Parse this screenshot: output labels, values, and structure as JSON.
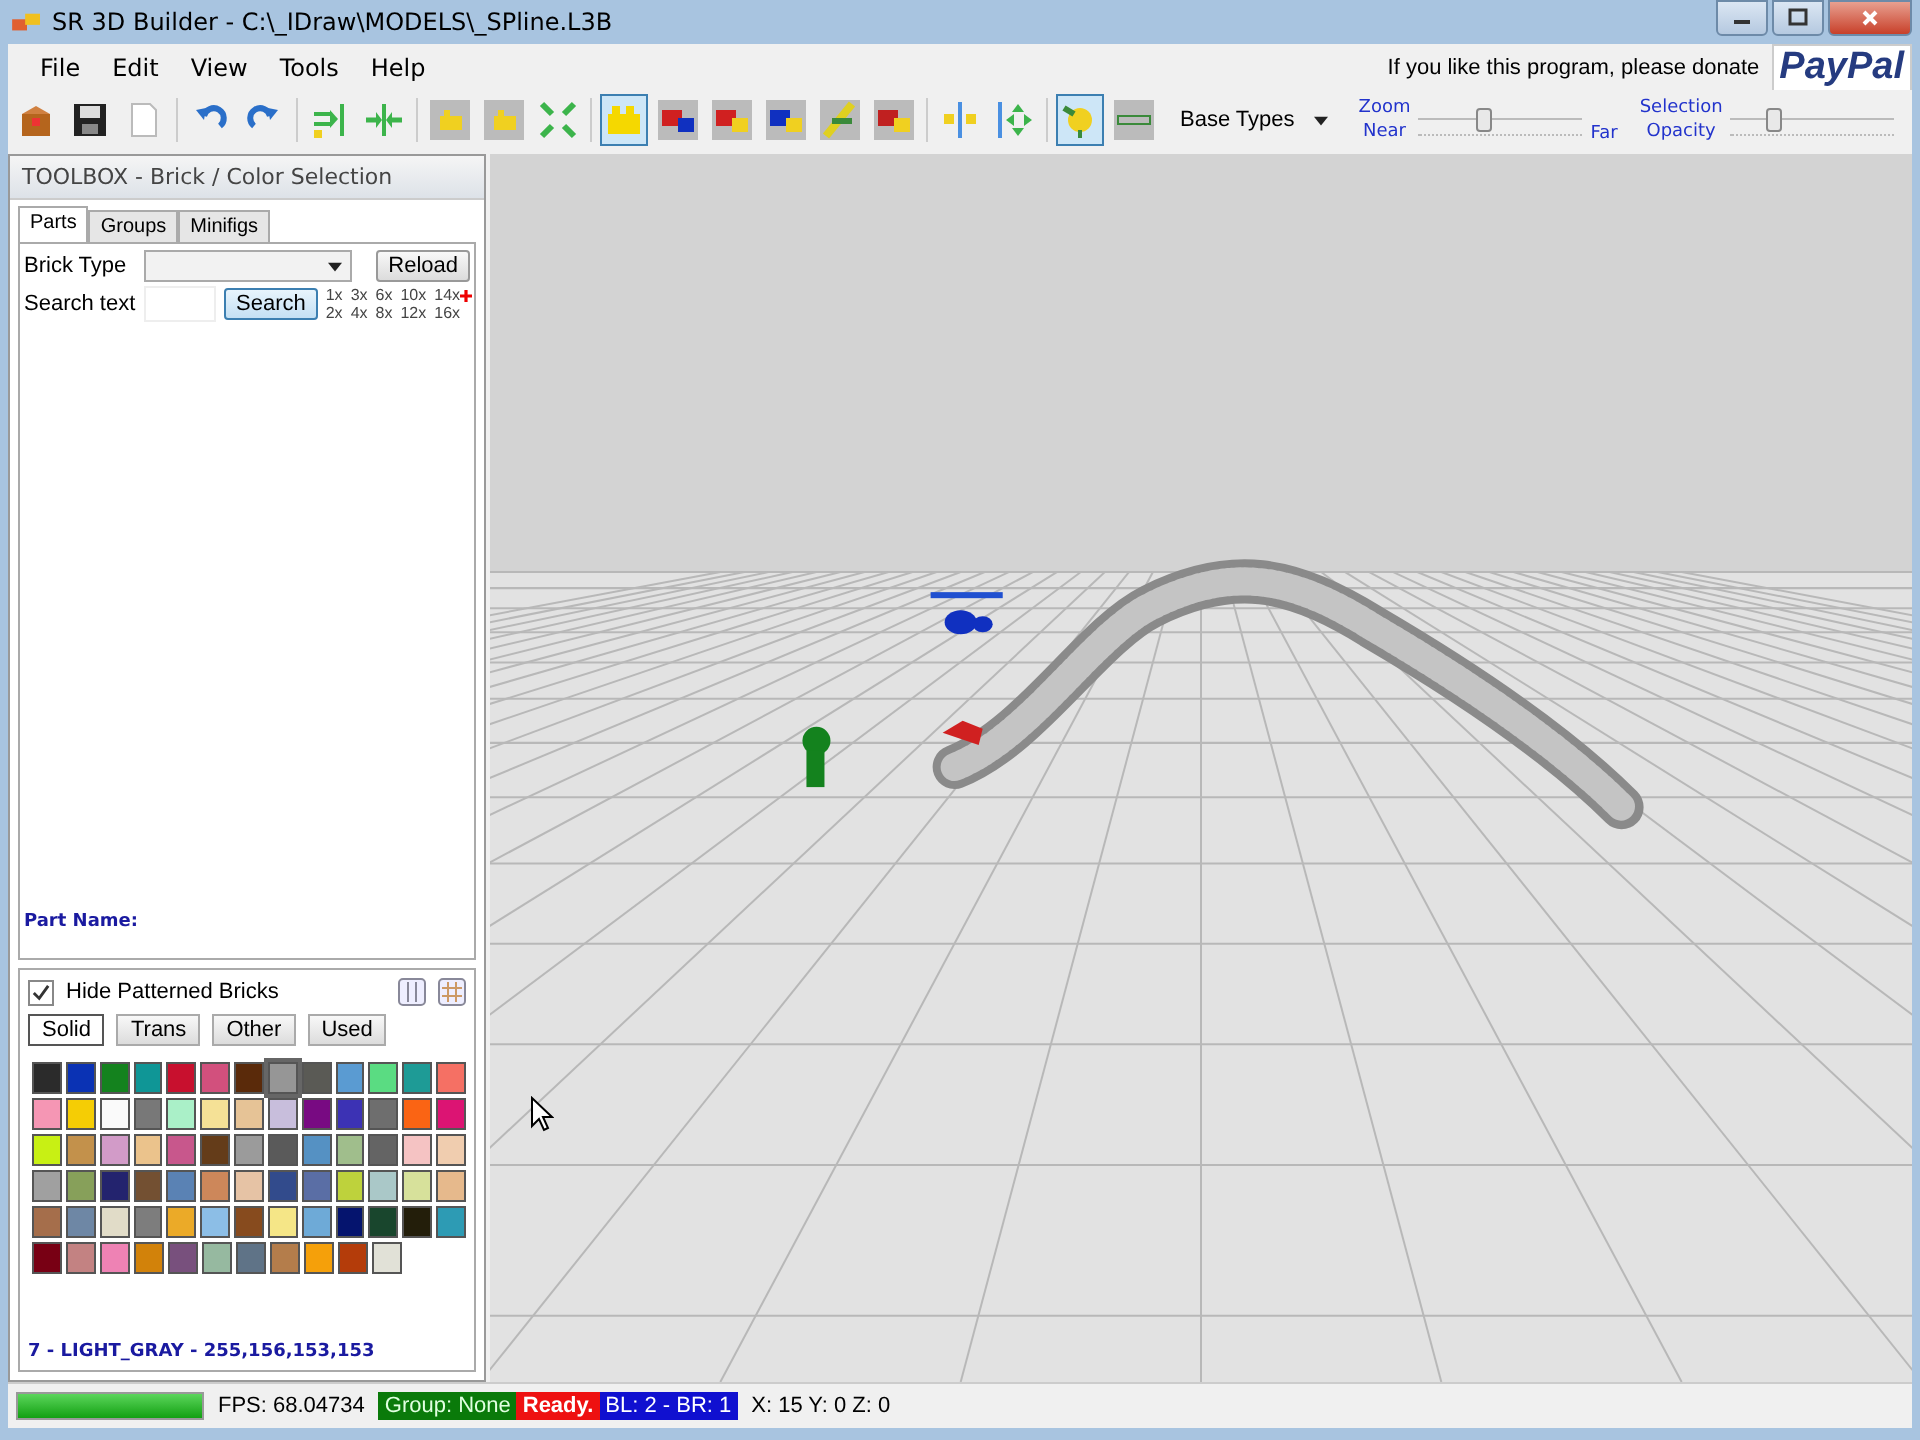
{
  "window": {
    "title": "SR 3D Builder - C:\\_IDraw\\MODELS\\_SPline.L3B"
  },
  "menu": [
    "File",
    "Edit",
    "View",
    "Tools",
    "Help"
  ],
  "donate": {
    "text": "If you like this program, please donate",
    "logo": "PayPal"
  },
  "toolbar": {
    "buttons": [
      {
        "selected": false
      },
      {
        "selected": false
      },
      {
        "selected": false
      },
      {
        "selected": false
      },
      {
        "selected": false
      },
      {
        "selected": false
      },
      {
        "selected": false
      },
      {
        "selected": false
      },
      {
        "selected": false
      },
      {
        "selected": false
      },
      {
        "selected": true
      },
      {
        "selected": false
      },
      {
        "selected": false
      },
      {
        "selected": false
      },
      {
        "selected": false
      },
      {
        "selected": false
      },
      {
        "selected": false
      },
      {
        "selected": false
      },
      {
        "selected": true
      },
      {
        "selected": false
      }
    ],
    "dropdown": "Base Types",
    "zoom": {
      "label_top": "Zoom",
      "label_bottom": "Near",
      "label_end": "Far",
      "level": 0.35
    },
    "opacity": {
      "label_top": "Selection",
      "label_bottom": "Opacity",
      "level": 0.22
    }
  },
  "toolbox": {
    "title": "TOOLBOX - Brick / Color Selection",
    "tabs": [
      {
        "label": "Parts",
        "selected": true
      },
      {
        "label": "Groups",
        "selected": false
      },
      {
        "label": "Minifigs",
        "selected": false
      }
    ],
    "brick_type_label": "Brick Type",
    "reload": "Reload",
    "search_label": "Search text",
    "search_button": "Search",
    "multipliers": [
      [
        "1x",
        "3x",
        "6x",
        "10x",
        "14x"
      ],
      [
        "2x",
        "4x",
        "8x",
        "12x",
        "16x"
      ]
    ],
    "part_name": "Part Name:",
    "hide_patterned": {
      "label": "Hide Patterned Bricks",
      "checked": true
    },
    "color_tabs": [
      {
        "label": "Solid",
        "selected": true
      },
      {
        "label": "Trans",
        "selected": false
      },
      {
        "label": "Other",
        "selected": false
      },
      {
        "label": "Used",
        "selected": false
      }
    ],
    "swatches": [
      [
        {
          "color": "#2b2b2b",
          "selected": false
        },
        {
          "color": "#0a32b4",
          "selected": false
        },
        {
          "color": "#14821e",
          "selected": false
        },
        {
          "color": "#0f9696",
          "selected": false
        },
        {
          "color": "#c8102e",
          "selected": false
        },
        {
          "color": "#d2507d",
          "selected": false
        },
        {
          "color": "#5a2a0a",
          "selected": false
        },
        {
          "color": "#969696",
          "selected": true
        },
        {
          "color": "#5a5a55",
          "selected": false
        },
        {
          "color": "#5a9bd2",
          "selected": false
        },
        {
          "color": "#5adc82",
          "selected": false
        },
        {
          "color": "#1e9b96",
          "selected": false
        },
        {
          "color": "#f57064",
          "selected": false
        }
      ],
      [
        {
          "color": "#f596b4",
          "selected": false
        },
        {
          "color": "#f5cd05",
          "selected": false
        },
        {
          "color": "#fafafa",
          "selected": false
        },
        {
          "color": "#787878",
          "selected": false
        },
        {
          "color": "#aaf0c8",
          "selected": false
        },
        {
          "color": "#f5e196",
          "selected": false
        },
        {
          "color": "#e6c396",
          "selected": false
        },
        {
          "color": "#c8bedc",
          "selected": false
        },
        {
          "color": "#780a82",
          "selected": false
        },
        {
          "color": "#3c32b4",
          "selected": false
        },
        {
          "color": "#6e6e6e",
          "selected": false
        },
        {
          "color": "#fa6414",
          "selected": false
        },
        {
          "color": "#dc1473",
          "selected": false
        }
      ],
      [
        {
          "color": "#c8f014",
          "selected": false
        },
        {
          "color": "#c3914b",
          "selected": false
        },
        {
          "color": "#d29bc8",
          "selected": false
        },
        {
          "color": "#ebc38c",
          "selected": false
        },
        {
          "color": "#c8578c",
          "selected": false
        },
        {
          "color": "#643c19",
          "selected": false
        },
        {
          "color": "#9b9b9b",
          "selected": false
        },
        {
          "color": "#5a5a5a",
          "selected": false
        },
        {
          "color": "#5591c3",
          "selected": false
        },
        {
          "color": "#a0be8c",
          "selected": false
        },
        {
          "color": "#646464",
          "selected": false
        },
        {
          "color": "#f5c3c3",
          "selected": false
        },
        {
          "color": "#f0cdaf",
          "selected": false
        }
      ],
      [
        {
          "color": "#a0a0a0",
          "selected": false
        },
        {
          "color": "#87a05a",
          "selected": false
        },
        {
          "color": "#23236e",
          "selected": false
        },
        {
          "color": "#735032",
          "selected": false
        },
        {
          "color": "#5a82b4",
          "selected": false
        },
        {
          "color": "#cd875a",
          "selected": false
        },
        {
          "color": "#e6c3a5",
          "selected": false
        },
        {
          "color": "#324b8c",
          "selected": false
        },
        {
          "color": "#5a6ea5",
          "selected": false
        },
        {
          "color": "#bed23c",
          "selected": false
        },
        {
          "color": "#aac8c8",
          "selected": false
        },
        {
          "color": "#d7e19b",
          "selected": false
        },
        {
          "color": "#e6b98c",
          "selected": false
        }
      ],
      [
        {
          "color": "#a56e4b",
          "selected": false
        },
        {
          "color": "#6e87a5",
          "selected": false
        },
        {
          "color": "#e1dcc8",
          "selected": false
        },
        {
          "color": "#7d7d7d",
          "selected": false
        },
        {
          "color": "#ebaa28",
          "selected": false
        },
        {
          "color": "#8cbee6",
          "selected": false
        },
        {
          "color": "#874b1e",
          "selected": false
        },
        {
          "color": "#f5e687",
          "selected": false
        },
        {
          "color": "#6eaad7",
          "selected": false
        },
        {
          "color": "#05146e",
          "selected": false
        },
        {
          "color": "#19462d",
          "selected": false
        },
        {
          "color": "#231e0a",
          "selected": false
        },
        {
          "color": "#2d9bb4",
          "selected": false
        }
      ],
      [
        {
          "color": "#780014",
          "selected": false
        },
        {
          "color": "#c38282",
          "selected": false
        },
        {
          "color": "#ee82b4",
          "selected": false
        },
        {
          "color": "#d2820a",
          "selected": false
        },
        {
          "color": "#78507d",
          "selected": false
        },
        {
          "color": "#96b9a0",
          "selected": false
        },
        {
          "color": "#5f7387",
          "selected": false
        },
        {
          "color": "#b47d4b",
          "selected": false
        },
        {
          "color": "#f5a00a",
          "selected": false
        },
        {
          "color": "#b43c0a",
          "selected": false
        },
        {
          "color": "#e1e1d7",
          "selected": false
        }
      ]
    ],
    "color_info": "7 - LIGHT_GRAY - 255,156,153,153"
  },
  "status_bar": {
    "level": 1,
    "fps": "FPS:  68.04734",
    "group": "Group: None",
    "ready": "Ready.",
    "bricks": "BL: 2 - BR: 1",
    "coords": "X: 15 Y: 0 Z: 0"
  }
}
